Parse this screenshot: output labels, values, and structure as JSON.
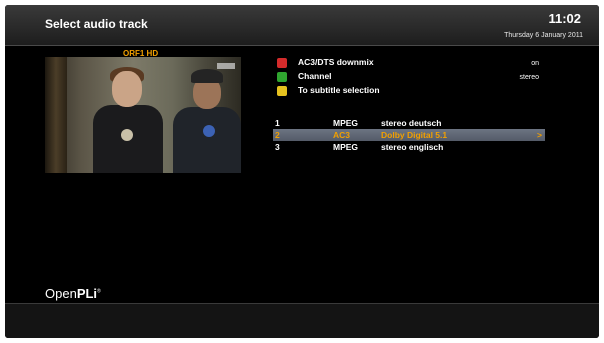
{
  "header": {
    "title": "Select audio track",
    "time": "11:02",
    "date": "Thursday  6 January 2011"
  },
  "preview": {
    "channel": "ORF1 HD"
  },
  "options": [
    {
      "key": "red",
      "color": "#d42b2b",
      "label": "AC3/DTS downmix",
      "value": "on"
    },
    {
      "key": "green",
      "color": "#2fa52f",
      "label": "Channel",
      "value": "stereo"
    },
    {
      "key": "yellow",
      "color": "#e6c21f",
      "label": "To subtitle selection",
      "value": ""
    }
  ],
  "tracks": [
    {
      "number": "1",
      "codec": "MPEG",
      "description": "stereo deutsch",
      "marker": "",
      "selected": false
    },
    {
      "number": "2",
      "codec": "AC3",
      "description": "Dolby Digital 5.1",
      "marker": ">",
      "selected": true
    },
    {
      "number": "3",
      "codec": "MPEG",
      "description": "stereo englisch",
      "marker": "",
      "selected": false
    }
  ],
  "brand": {
    "part1": "Open",
    "part2": "PLi",
    "suffix": "®"
  },
  "colors": {
    "accent": "#f2a000",
    "selection_bar": "#5f6775",
    "background": "#000000"
  }
}
